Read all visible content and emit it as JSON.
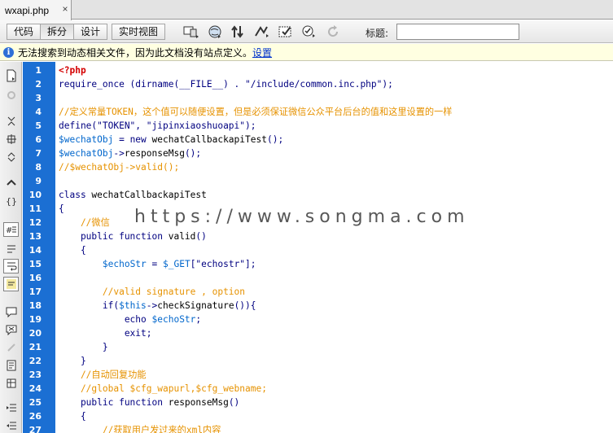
{
  "document_tab": {
    "filename": "wxapi.php",
    "close_glyph": "×"
  },
  "toolbar": {
    "view_buttons": [
      "代码",
      "拆分",
      "设计",
      "实时视图"
    ],
    "icons": [
      "multiscreen-icon",
      "preview-globe-icon",
      "file-transfer-icon",
      "debug-icon",
      "visual-aids-icon",
      "validate-icon",
      "refresh-icon"
    ],
    "title_label": "标题:",
    "title_value": ""
  },
  "infobar": {
    "message": "无法搜索到动态相关文件，因为此文档没有站点定义。",
    "link": "设置"
  },
  "side_tools": [
    "open-documents-icon",
    "show-code-navigator-icon",
    "collapse-full-tag-icon",
    "collapse-selection-icon",
    "expand-all-icon",
    "select-parent-tag-icon",
    "balance-braces-icon",
    "line-numbers-icon",
    "highlight-invalid-code-icon",
    "word-wrap-icon",
    "syntax-coloring-icon",
    "apply-comment-icon",
    "remove-comment-icon",
    "wrap-tag-icon",
    "recent-snippets-icon",
    "move-css-icon",
    "indent-code-icon",
    "outdent-code-icon",
    "format-source-icon"
  ],
  "editor": {
    "line_numbers": [
      "1",
      "2",
      "3",
      "4",
      "5",
      "6",
      "7",
      "8",
      "9",
      "10",
      "11",
      "12",
      "13",
      "14",
      "15",
      "16",
      "17",
      "18",
      "19",
      "20",
      "21",
      "22",
      "23",
      "24",
      "25",
      "26",
      "27"
    ],
    "lines": [
      "<?php",
      "require_once (dirname(__FILE__) . \"/include/common.inc.php\");",
      "",
      "//定义常量TOKEN，这个值可以随便设置，但是必须保证微信公众平台后台的值和这里设置的一样",
      "define(\"TOKEN\", \"jipinxiaoshuoapi\");",
      "$wechatObj = new wechatCallbackapiTest();",
      "$wechatObj->responseMsg();",
      "//$wechatObj->valid();",
      "",
      "class wechatCallbackapiTest",
      "{",
      "    //微信",
      "    public function valid()",
      "    {",
      "        $echoStr = $_GET[\"echostr\"];",
      "",
      "        //valid signature , option",
      "        if($this->checkSignature()){",
      "            echo $echoStr;",
      "            exit;",
      "        }",
      "    }",
      "    //自动回复功能",
      "    //global $cfg_wapurl,$cfg_webname;",
      "    public function responseMsg()",
      "    {",
      "        //获取用户发过来的xml内容"
    ]
  },
  "watermark": "https://www.songma.com"
}
